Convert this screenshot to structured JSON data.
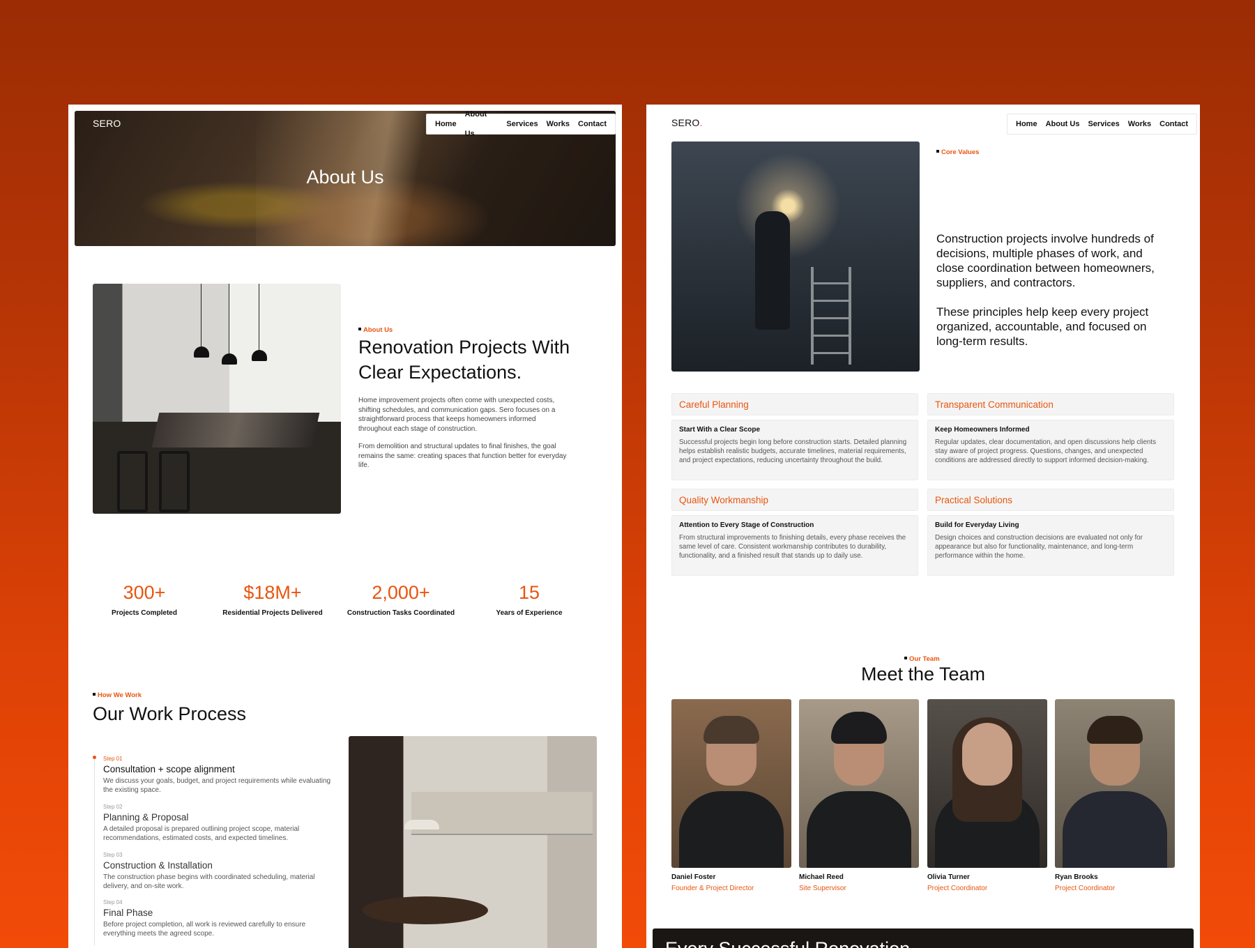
{
  "left": {
    "logo": "SERO",
    "nav": [
      "Home",
      "About Us",
      "Services",
      "Works",
      "Contact"
    ],
    "hero_title": "About Us",
    "about": {
      "eyebrow": "About Us",
      "title_line1": "Renovation Projects With",
      "title_line2": "Clear Expectations.",
      "para1": "Home improvement projects often come with unexpected costs, shifting schedules, and communication gaps. Sero focuses on a straightforward process that keeps homeowners informed throughout each stage of construction.",
      "para2": "From demolition and structural updates to final finishes, the goal remains the same: creating spaces that function better for everyday life."
    },
    "stats": [
      {
        "value": "300+",
        "label": "Projects Completed"
      },
      {
        "value": "$18M+",
        "label": "Residential Projects Delivered"
      },
      {
        "value": "2,000+",
        "label": "Construction Tasks Coordinated"
      },
      {
        "value": "15",
        "label": "Years of Experience"
      }
    ],
    "process": {
      "eyebrow": "How We Work",
      "title": "Our Work Process",
      "steps": [
        {
          "num": "Step 01",
          "title": "Consultation + scope alignment",
          "desc": "We discuss your goals, budget, and project requirements while evaluating the existing space."
        },
        {
          "num": "Step 02",
          "title": "Planning & Proposal",
          "desc": "A detailed proposal is prepared outlining project scope, material recommendations, estimated costs, and expected timelines."
        },
        {
          "num": "Step 03",
          "title": "Construction & Installation",
          "desc": "The construction phase begins with coordinated scheduling, material delivery, and on-site work."
        },
        {
          "num": "Step 04",
          "title": "Final Phase",
          "desc": "Before project completion, all work is reviewed carefully to ensure everything meets the agreed scope."
        }
      ]
    }
  },
  "right": {
    "logo": "SERO",
    "logo_dot": ".",
    "nav": [
      "Home",
      "About Us",
      "Services",
      "Works",
      "Contact"
    ],
    "core": {
      "eyebrow": "Core Values",
      "text1": "Construction projects involve hundreds of decisions, multiple phases of work, and close coordination between homeowners, suppliers, and contractors.",
      "text2": "These principles help keep every project organized, accountable, and focused on long-term results."
    },
    "values": [
      {
        "title": "Careful Planning",
        "sub": "Start With a Clear Scope",
        "desc": "Successful projects begin long before construction starts. Detailed planning helps establish realistic budgets, accurate timelines, material requirements, and project expectations, reducing uncertainty throughout the build."
      },
      {
        "title": "Transparent Communication",
        "sub": "Keep Homeowners Informed",
        "desc": "Regular updates, clear documentation, and open discussions help clients stay aware of project progress. Questions, changes, and unexpected conditions are addressed directly to support informed decision-making."
      },
      {
        "title": "Quality Workmanship",
        "sub": "Attention to Every Stage of Construction",
        "desc": "From structural improvements to finishing details, every phase receives the same level of care. Consistent workmanship contributes to durability, functionality, and a finished result that stands up to daily use."
      },
      {
        "title": "Practical Solutions",
        "sub": "Build for Everyday Living",
        "desc": "Design choices and construction decisions are evaluated not only for appearance but also for functionality, maintenance, and long-term performance within the home."
      }
    ],
    "team": {
      "eyebrow": "Our Team",
      "title": "Meet the Team",
      "members": [
        {
          "name": "Daniel Foster",
          "role": "Founder & Project Director"
        },
        {
          "name": "Michael Reed",
          "role": "Site Supervisor"
        },
        {
          "name": "Olivia Turner",
          "role": "Project Coordinator"
        },
        {
          "name": "Ryan Brooks",
          "role": "Project Coordinator"
        }
      ]
    },
    "banner_text": "Every Successful Renovation"
  },
  "colors": {
    "accent": "#e8550f",
    "background_top": "#9b2c04",
    "background_bottom": "#f24b08"
  }
}
